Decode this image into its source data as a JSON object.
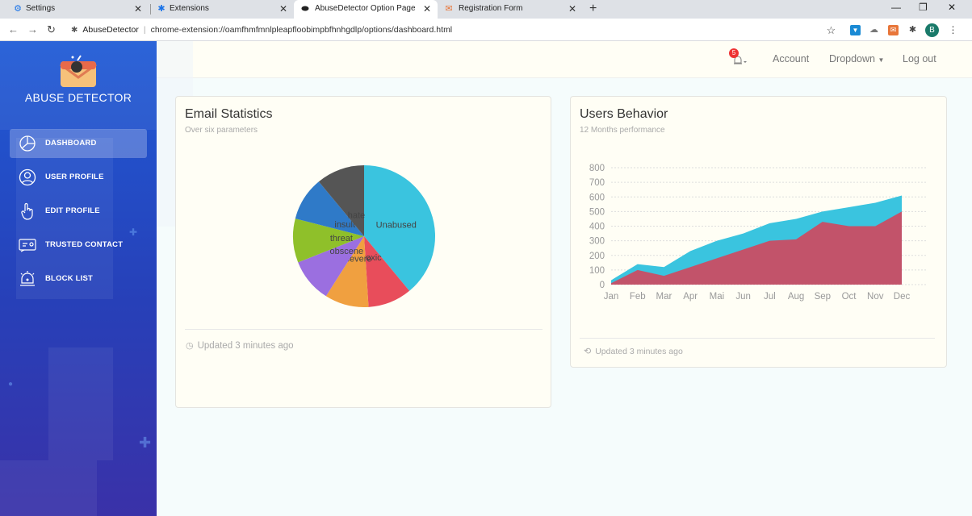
{
  "browser": {
    "tabs": [
      {
        "label": "Settings",
        "icon": "gear-icon",
        "color": "#1a73e8"
      },
      {
        "label": "Extensions",
        "icon": "puzzle-icon",
        "color": "#1a73e8"
      },
      {
        "label": "AbuseDetector Option Page",
        "icon": "extension-icon",
        "color": "#222222"
      },
      {
        "label": "Registration Form",
        "icon": "mail-icon",
        "color": "#e8763a"
      }
    ],
    "new_tab": "+",
    "site_name": "AbuseDetector",
    "url": "chrome-extension://oamfhmfmnlpleapfloobimpbfhnhgdlp/options/dashboard.html",
    "profile_initial": "B"
  },
  "sidebar": {
    "brand": "ABUSE DETECTOR",
    "items": [
      {
        "label": "DASHBOARD",
        "icon": "pie-chart-icon",
        "active": true
      },
      {
        "label": "USER PROFILE",
        "icon": "user-icon",
        "active": false
      },
      {
        "label": "EDIT PROFILE",
        "icon": "hand-pointer-icon",
        "active": false
      },
      {
        "label": "TRUSTED CONTACT",
        "icon": "contact-card-icon",
        "active": false
      },
      {
        "label": "BLOCK LIST",
        "icon": "alarm-bell-icon",
        "active": false
      }
    ]
  },
  "topnav": {
    "notification_count": "5",
    "account": "Account",
    "dropdown": "Dropdown",
    "logout": "Log out"
  },
  "email_card": {
    "title": "Email Statistics",
    "subtitle": "Over six parameters",
    "footer": "Updated 3 minutes ago"
  },
  "behavior_card": {
    "title": "Users Behavior",
    "subtitle": "12 Months performance",
    "footer": "Updated 3 minutes ago"
  },
  "chart_data": [
    {
      "type": "pie",
      "slices": [
        {
          "label": "Unabused",
          "value": 39,
          "color": "#3ac4df"
        },
        {
          "label": "toxic",
          "value": 10,
          "color": "#e84d5b"
        },
        {
          "label": "severe",
          "value": 10,
          "color": "#f0a040"
        },
        {
          "label": "obscene",
          "value": 10,
          "color": "#9b6fe0"
        },
        {
          "label": "threat",
          "value": 10,
          "color": "#8fc02a"
        },
        {
          "label": "insult",
          "value": 10,
          "color": "#2f7ac8"
        },
        {
          "label": "hate",
          "value": 11,
          "color": "#555555"
        }
      ]
    },
    {
      "type": "area",
      "categories": [
        "Jan",
        "Feb",
        "Mar",
        "Apr",
        "Mai",
        "Jun",
        "Jul",
        "Aug",
        "Sep",
        "Oct",
        "Nov",
        "Dec"
      ],
      "series": [
        {
          "values": [
            30,
            140,
            120,
            230,
            300,
            350,
            420,
            450,
            500,
            530,
            560,
            610
          ],
          "color": "#3ac4df"
        },
        {
          "values": [
            10,
            100,
            60,
            120,
            180,
            240,
            300,
            310,
            430,
            400,
            400,
            500
          ],
          "color": "#c2536a"
        }
      ],
      "yticks": [
        0,
        100,
        200,
        300,
        400,
        500,
        600,
        700,
        800
      ],
      "ylim": [
        0,
        800
      ],
      "grid": true
    }
  ]
}
